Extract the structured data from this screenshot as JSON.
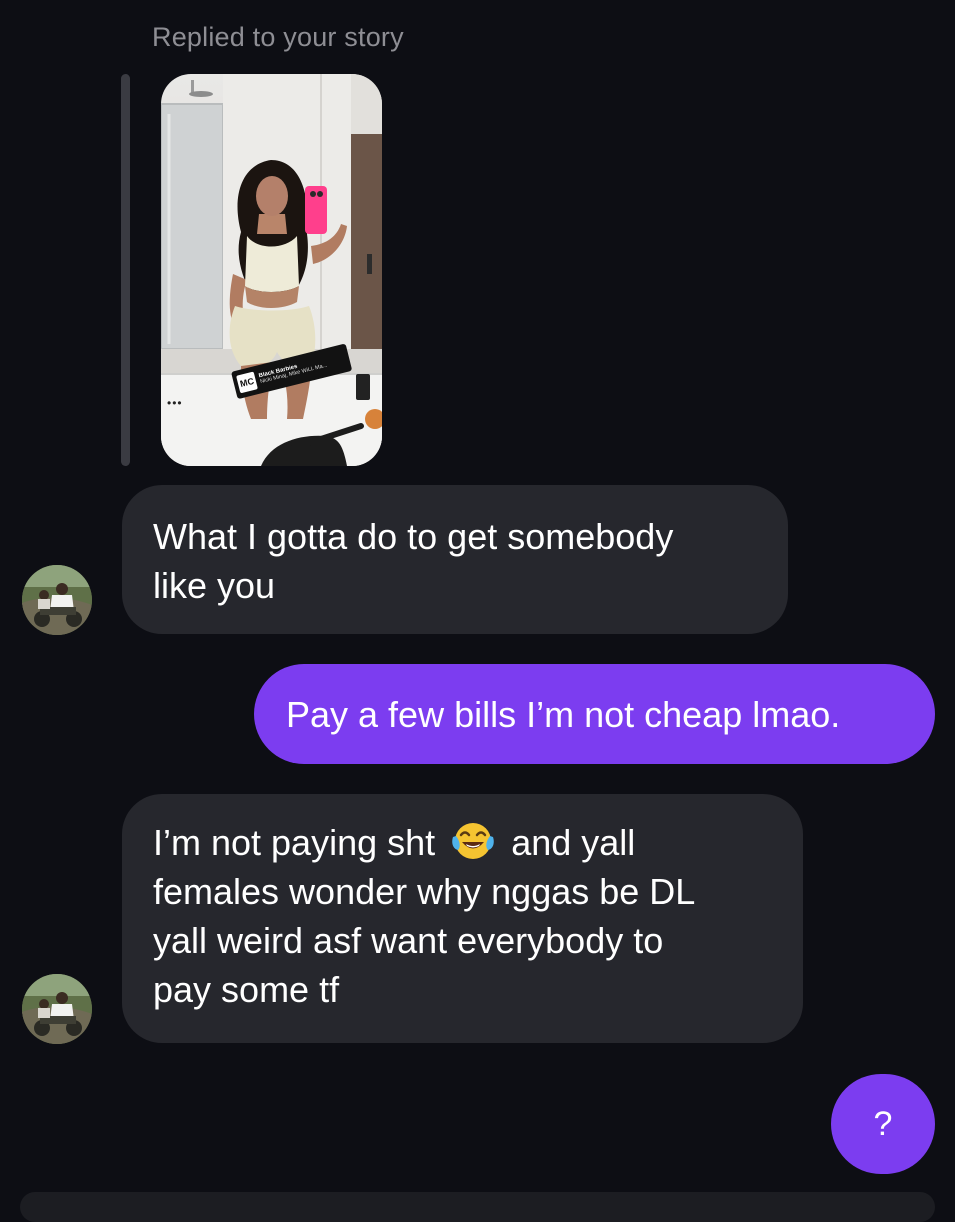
{
  "story_reply": {
    "caption": "Replied to your story",
    "music_sticker": {
      "title": "Black Barbies",
      "artist": "Nicki Minaj, Mike WiLL Ma...",
      "icon_text": "MC"
    }
  },
  "messages": [
    {
      "direction": "incoming",
      "lines": [
        "What I gotta do to get somebody",
        "like you"
      ]
    },
    {
      "direction": "outgoing",
      "text": "Pay a few bills I’m not cheap lmao."
    },
    {
      "direction": "incoming",
      "line1_before_emoji": "I’m not paying sht",
      "emoji": "face-with-tears-of-joy",
      "line1_after_emoji": "and yall",
      "lines": [
        "females wonder why nggas be DL",
        "yall weird asf want everybody to",
        "pay some tf"
      ]
    },
    {
      "direction": "outgoing",
      "text": "?"
    }
  ],
  "colors": {
    "background": "#0d0e14",
    "incoming_bubble": "#26272d",
    "outgoing_bubble": "#7c3df0",
    "caption": "#8e8e94"
  }
}
